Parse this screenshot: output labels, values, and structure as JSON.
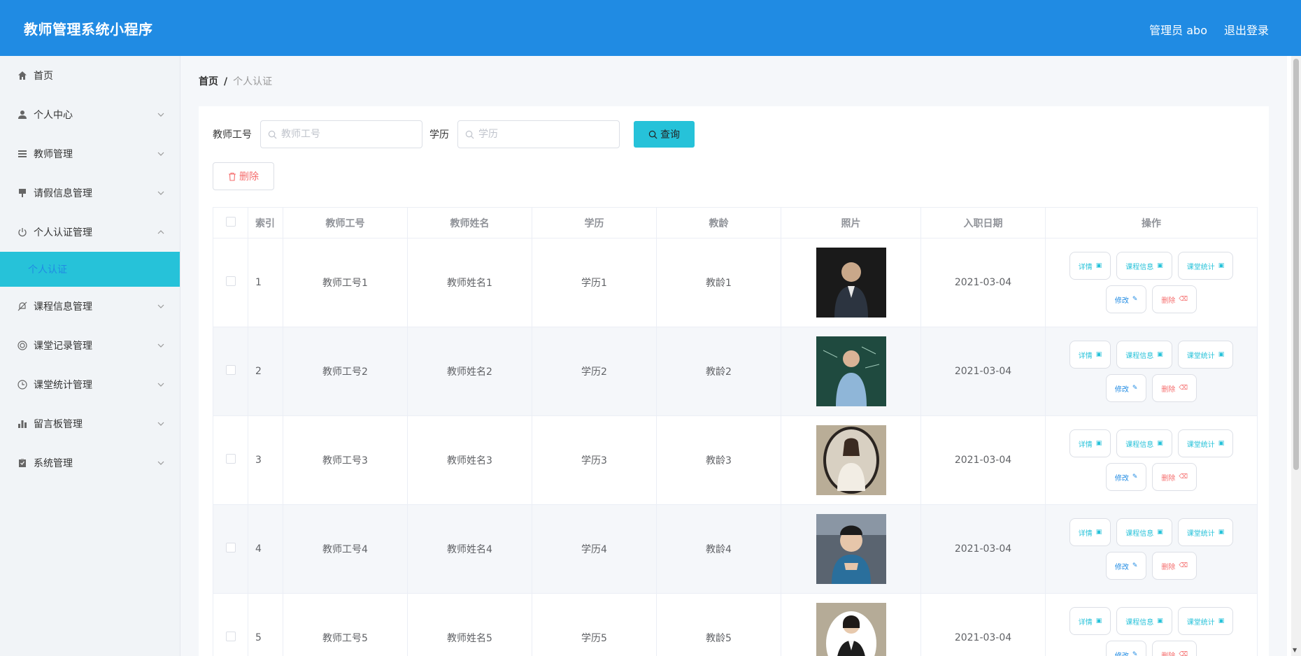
{
  "header": {
    "title": "教师管理系统小程序",
    "user": "管理员 abo",
    "logout": "退出登录"
  },
  "sidebar": {
    "items": [
      {
        "label": "首页",
        "icon": "home-icon",
        "has_children": false
      },
      {
        "label": "个人中心",
        "icon": "user-icon",
        "has_children": true
      },
      {
        "label": "教师管理",
        "icon": "list-icon",
        "has_children": true
      },
      {
        "label": "请假信息管理",
        "icon": "brush-icon",
        "has_children": true
      },
      {
        "label": "个人认证管理",
        "icon": "power-icon",
        "has_children": true,
        "expanded": true
      },
      {
        "label": "课程信息管理",
        "icon": "bell-off-icon",
        "has_children": true
      },
      {
        "label": "课堂记录管理",
        "icon": "lifebuoy-icon",
        "has_children": true
      },
      {
        "label": "课堂统计管理",
        "icon": "clock-icon",
        "has_children": true
      },
      {
        "label": "留言板管理",
        "icon": "bar-chart-icon",
        "has_children": true
      },
      {
        "label": "系统管理",
        "icon": "clipboard-icon",
        "has_children": true
      }
    ],
    "active_sub": "个人认证"
  },
  "breadcrumb": {
    "home": "首页",
    "separator": "/",
    "current": "个人认证"
  },
  "search": {
    "field1_label": "教师工号",
    "field1_placeholder": "教师工号",
    "field2_label": "学历",
    "field2_placeholder": "学历",
    "query_button": "查询"
  },
  "delete_button": "删除",
  "table": {
    "headers": [
      "索引",
      "教师工号",
      "教师姓名",
      "学历",
      "教龄",
      "照片",
      "入职日期",
      "操作"
    ],
    "rows": [
      {
        "index": "1",
        "id": "教师工号1",
        "name": "教师姓名1",
        "edu": "学历1",
        "age": "教龄1",
        "date": "2021-03-04"
      },
      {
        "index": "2",
        "id": "教师工号2",
        "name": "教师姓名2",
        "edu": "学历2",
        "age": "教龄2",
        "date": "2021-03-04"
      },
      {
        "index": "3",
        "id": "教师工号3",
        "name": "教师姓名3",
        "edu": "学历3",
        "age": "教龄3",
        "date": "2021-03-04"
      },
      {
        "index": "4",
        "id": "教师工号4",
        "name": "教师姓名4",
        "edu": "学历4",
        "age": "教龄4",
        "date": "2021-03-04"
      },
      {
        "index": "5",
        "id": "教师工号5",
        "name": "教师姓名5",
        "edu": "学历5",
        "age": "教龄5",
        "date": "2021-03-04"
      }
    ],
    "ops": {
      "detail": "详情",
      "course": "课程信息",
      "stats": "课堂统计",
      "edit": "修改",
      "delete": "删除"
    }
  },
  "colors": {
    "header": "#208be3",
    "accent": "#26c2d9",
    "danger": "#f56c6c",
    "sidebar_bg": "#f1f4f7"
  }
}
